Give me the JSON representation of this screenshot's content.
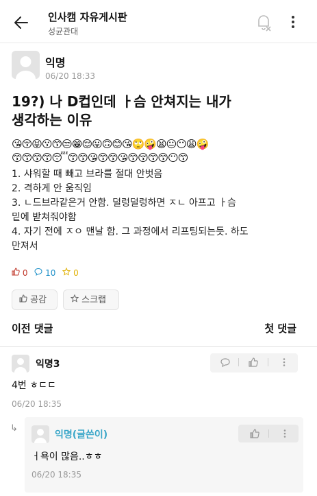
{
  "header": {
    "title": "인사캠 자유게시판",
    "subtitle": "성균관대"
  },
  "post": {
    "author": "익명",
    "date": "06/20 18:33",
    "title_line1": "19?) 나 D컵인데 ㅏ슴 안쳐지는 내가",
    "title_line2": "생각하는 이유",
    "emoji_line1": "😘😚😝😗😙😒😁😌😛🙃😊😘🙄🤪😫😐😶😩🤪",
    "emoji_line2": "😙😙😙😙😴😙😙😘😙😙😘😙😚😙😙😶😙",
    "lines": [
      "1. 샤워할 때 빼고 브라를 절대 안벗음",
      "2. 격하게 안 움직임",
      "3. ㄴ드브라같은거 안함. 덜렁덜렁하면 ㅈㄴ 아프고 ㅏ슴",
      "밑에 받쳐줘야함",
      "4. 자기 전에 ㅈㅇ 맨날 함. 그 과정에서 리프팅되는듯. 하도",
      "만져서"
    ],
    "stats": {
      "likes": "0",
      "comments": "10",
      "scraps": "0"
    },
    "like_button": "공감",
    "scrap_button": "스크랩"
  },
  "nav": {
    "prev": "이전 댓글",
    "first": "첫 댓글"
  },
  "comments": [
    {
      "author": "익명3",
      "text": "4번 ㅎㄷㄷ",
      "date": "06/20 18:35"
    },
    {
      "author": "익명(글쓴이)",
      "text": "ㅓ욕이 많음..ㅎㅎ",
      "date": "06/20 18:35"
    }
  ],
  "colors": {
    "like": "#c0392b",
    "comment": "#1e90c8",
    "scrap": "#e0b000",
    "writer": "#3aa6c8"
  }
}
